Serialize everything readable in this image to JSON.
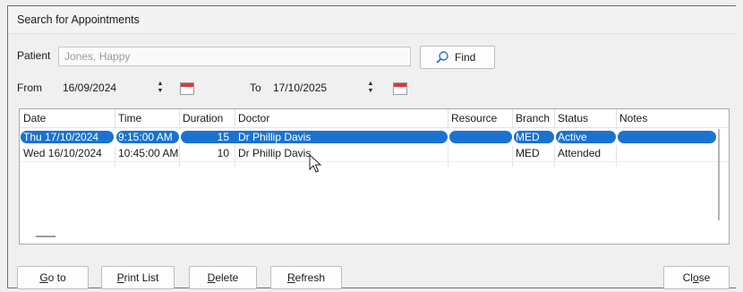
{
  "window": {
    "title": "Search for Appointments"
  },
  "patient": {
    "label": "Patient",
    "value": "Jones, Happy"
  },
  "find_button": {
    "label": "Find"
  },
  "date_range": {
    "from_label": "From",
    "from_value": "16/09/2024",
    "to_label": "To",
    "to_value": "17/10/2025"
  },
  "table": {
    "columns": [
      "Date",
      "Time",
      "Duration",
      "Doctor",
      "Resource",
      "Branch",
      "Status",
      "Notes"
    ],
    "rows": [
      {
        "date": "Thu 17/10/2024",
        "time": "9:15:00 AM",
        "duration": "15",
        "doctor": "Dr Phillip Davis",
        "resource": "",
        "branch": "MED",
        "status": "Active",
        "notes": "",
        "selected": true
      },
      {
        "date": "Wed 16/10/2024",
        "time": "10:45:00 AM",
        "duration": "10",
        "doctor": "Dr Phillip Davis",
        "resource": "",
        "branch": "MED",
        "status": "Attended",
        "notes": "",
        "selected": false
      }
    ]
  },
  "buttons": {
    "goto": {
      "underline": "G",
      "rest": "o to"
    },
    "print_list": {
      "underline": "P",
      "rest": "rint List"
    },
    "delete": {
      "underline": "D",
      "rest": "elete"
    },
    "refresh": {
      "underline": "R",
      "rest": "efresh"
    },
    "close": {
      "prefix": "Cl",
      "underline": "o",
      "rest": "se"
    }
  },
  "colors": {
    "selection": "#1a73d1",
    "calendar_icon": "#d93a3a"
  }
}
